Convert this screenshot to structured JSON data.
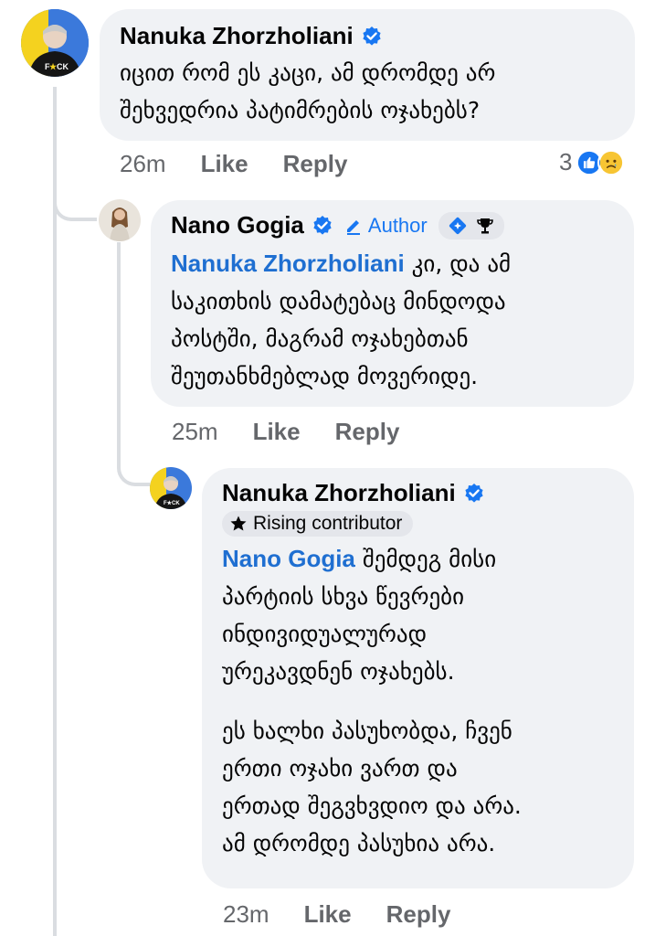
{
  "comments": [
    {
      "author": "Nanuka Zhorzholiani",
      "verified": true,
      "text_lines": [
        "იცით რომ ეს კაცი, ამ დრომდე არ",
        "შეხვედრია პატიმრების ოჯახებს?"
      ],
      "time": "26m",
      "like_label": "Like",
      "reply_label": "Reply",
      "reaction_count": "3",
      "reactions": [
        "like",
        "sad"
      ]
    },
    {
      "author": "Nano Gogia",
      "verified": true,
      "author_badge": "Author",
      "mention": "Nanuka Zhorzholiani",
      "text_lines": [
        "კი, და ამ",
        "საკითხის დამატებაც მინდოდა",
        "პოსტში, მაგრამ ოჯახებთან",
        "შეუთანხმებლად მოვერიდე."
      ],
      "time": "25m",
      "like_label": "Like",
      "reply_label": "Reply"
    },
    {
      "author": "Nanuka Zhorzholiani",
      "verified": true,
      "badge": "Rising contributor",
      "mention": "Nano Gogia",
      "text_lines": [
        "შემდეგ მისი",
        "პარტიის სხვა წევრები",
        "ინდივიდუალურად",
        "ურეკავდნენ ოჯახებს."
      ],
      "text_lines_2": [
        "ეს ხალხი პასუხობდა, ჩვენ",
        "ერთი ოჯახი ვართ და",
        "ერთად შეგვხვდიო და არა.",
        "ამ დრომდე პასუხია არა."
      ],
      "time": "23m",
      "like_label": "Like",
      "reply_label": "Reply"
    }
  ],
  "colors": {
    "bubble": "#f0f2f5",
    "mention": "#1f6fd1",
    "meta": "#65676b",
    "verified": "#1877f2",
    "thread_line": "#dadde1"
  },
  "icons": [
    "verified-badge-icon",
    "pencil-icon",
    "diamond-badge-icon",
    "trophy-icon",
    "star-icon",
    "like-reaction-icon",
    "sad-reaction-icon"
  ]
}
